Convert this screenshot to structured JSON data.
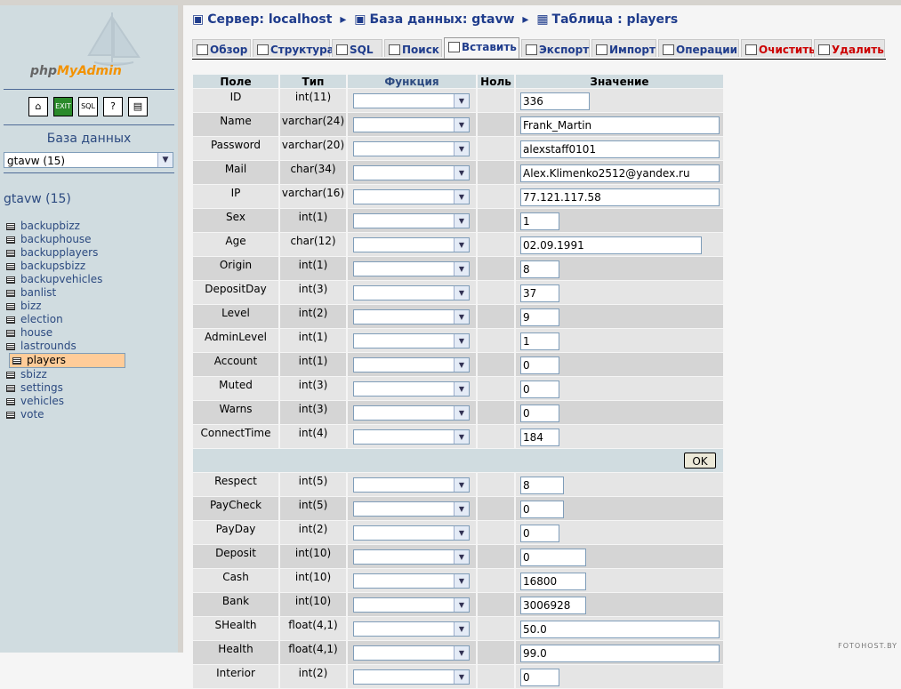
{
  "nav": {
    "logo_php": "php",
    "logo_myadmin": "MyAdmin",
    "database_label": "База данных",
    "database_select": "gtavw (15)",
    "db_title": "gtavw (15)",
    "tables": [
      "backupbizz",
      "backuphouse",
      "backupplayers",
      "backupsbizz",
      "backupvehicles",
      "banlist",
      "bizz",
      "election",
      "house",
      "lastrounds",
      "players",
      "sbizz",
      "settings",
      "vehicles",
      "vote"
    ],
    "selected_table": "players"
  },
  "breadcrumb": {
    "server": "Сервер: localhost",
    "database": "База данных: gtavw",
    "table": "Таблица : players"
  },
  "tabs": [
    {
      "label": "Обзор",
      "active": false,
      "red": false
    },
    {
      "label": "Структура",
      "active": false,
      "red": false
    },
    {
      "label": "SQL",
      "active": false,
      "red": false
    },
    {
      "label": "Поиск",
      "active": false,
      "red": false
    },
    {
      "label": "Вставить",
      "active": true,
      "red": false
    },
    {
      "label": "Экспорт",
      "active": false,
      "red": false
    },
    {
      "label": "Импорт",
      "active": false,
      "red": false
    },
    {
      "label": "Операции",
      "active": false,
      "red": false
    },
    {
      "label": "Очистить",
      "active": false,
      "red": true
    },
    {
      "label": "Удалить",
      "active": false,
      "red": true
    }
  ],
  "table_headers": {
    "field": "Поле",
    "type": "Тип",
    "function": "Функция",
    "null": "Ноль",
    "value": "Значение"
  },
  "rows_top": [
    {
      "field": "ID",
      "type": "int(11)",
      "value": "336",
      "width": 78
    },
    {
      "field": "Name",
      "type": "varchar(24)",
      "value": "Frank_Martin",
      "width": 224
    },
    {
      "field": "Password",
      "type": "varchar(20)",
      "value": "alexstaff0101",
      "width": 224
    },
    {
      "field": "Mail",
      "type": "char(34)",
      "value": "Alex.Klimenko2512@yandex.ru",
      "width": 224
    },
    {
      "field": "IP",
      "type": "varchar(16)",
      "value": "77.121.117.58",
      "width": 224
    },
    {
      "field": "Sex",
      "type": "int(1)",
      "value": "1",
      "width": 44
    },
    {
      "field": "Age",
      "type": "char(12)",
      "value": "02.09.1991",
      "width": 204
    },
    {
      "field": "Origin",
      "type": "int(1)",
      "value": "8",
      "width": 44
    },
    {
      "field": "DepositDay",
      "type": "int(3)",
      "value": "37",
      "width": 44
    },
    {
      "field": "Level",
      "type": "int(2)",
      "value": "9",
      "width": 44
    },
    {
      "field": "AdminLevel",
      "type": "int(1)",
      "value": "1",
      "width": 44
    },
    {
      "field": "Account",
      "type": "int(1)",
      "value": "0",
      "width": 44
    },
    {
      "field": "Muted",
      "type": "int(3)",
      "value": "0",
      "width": 44
    },
    {
      "field": "Warns",
      "type": "int(3)",
      "value": "0",
      "width": 44
    },
    {
      "field": "ConnectTime",
      "type": "int(4)",
      "value": "184",
      "width": 44
    }
  ],
  "ok_label": "OK",
  "rows_bottom": [
    {
      "field": "Respect",
      "type": "int(5)",
      "value": "8",
      "width": 49
    },
    {
      "field": "PayCheck",
      "type": "int(5)",
      "value": "0",
      "width": 49
    },
    {
      "field": "PayDay",
      "type": "int(2)",
      "value": "0",
      "width": 44
    },
    {
      "field": "Deposit",
      "type": "int(10)",
      "value": "0",
      "width": 74
    },
    {
      "field": "Cash",
      "type": "int(10)",
      "value": "16800",
      "width": 74
    },
    {
      "field": "Bank",
      "type": "int(10)",
      "value": "3006928",
      "width": 74
    },
    {
      "field": "SHealth",
      "type": "float(4,1)",
      "value": "50.0",
      "width": 224
    },
    {
      "field": "Health",
      "type": "float(4,1)",
      "value": "99.0",
      "width": 224
    },
    {
      "field": "Interior",
      "type": "int(2)",
      "value": "0",
      "width": 44
    }
  ],
  "watermark": "FOTOHOST.BY"
}
